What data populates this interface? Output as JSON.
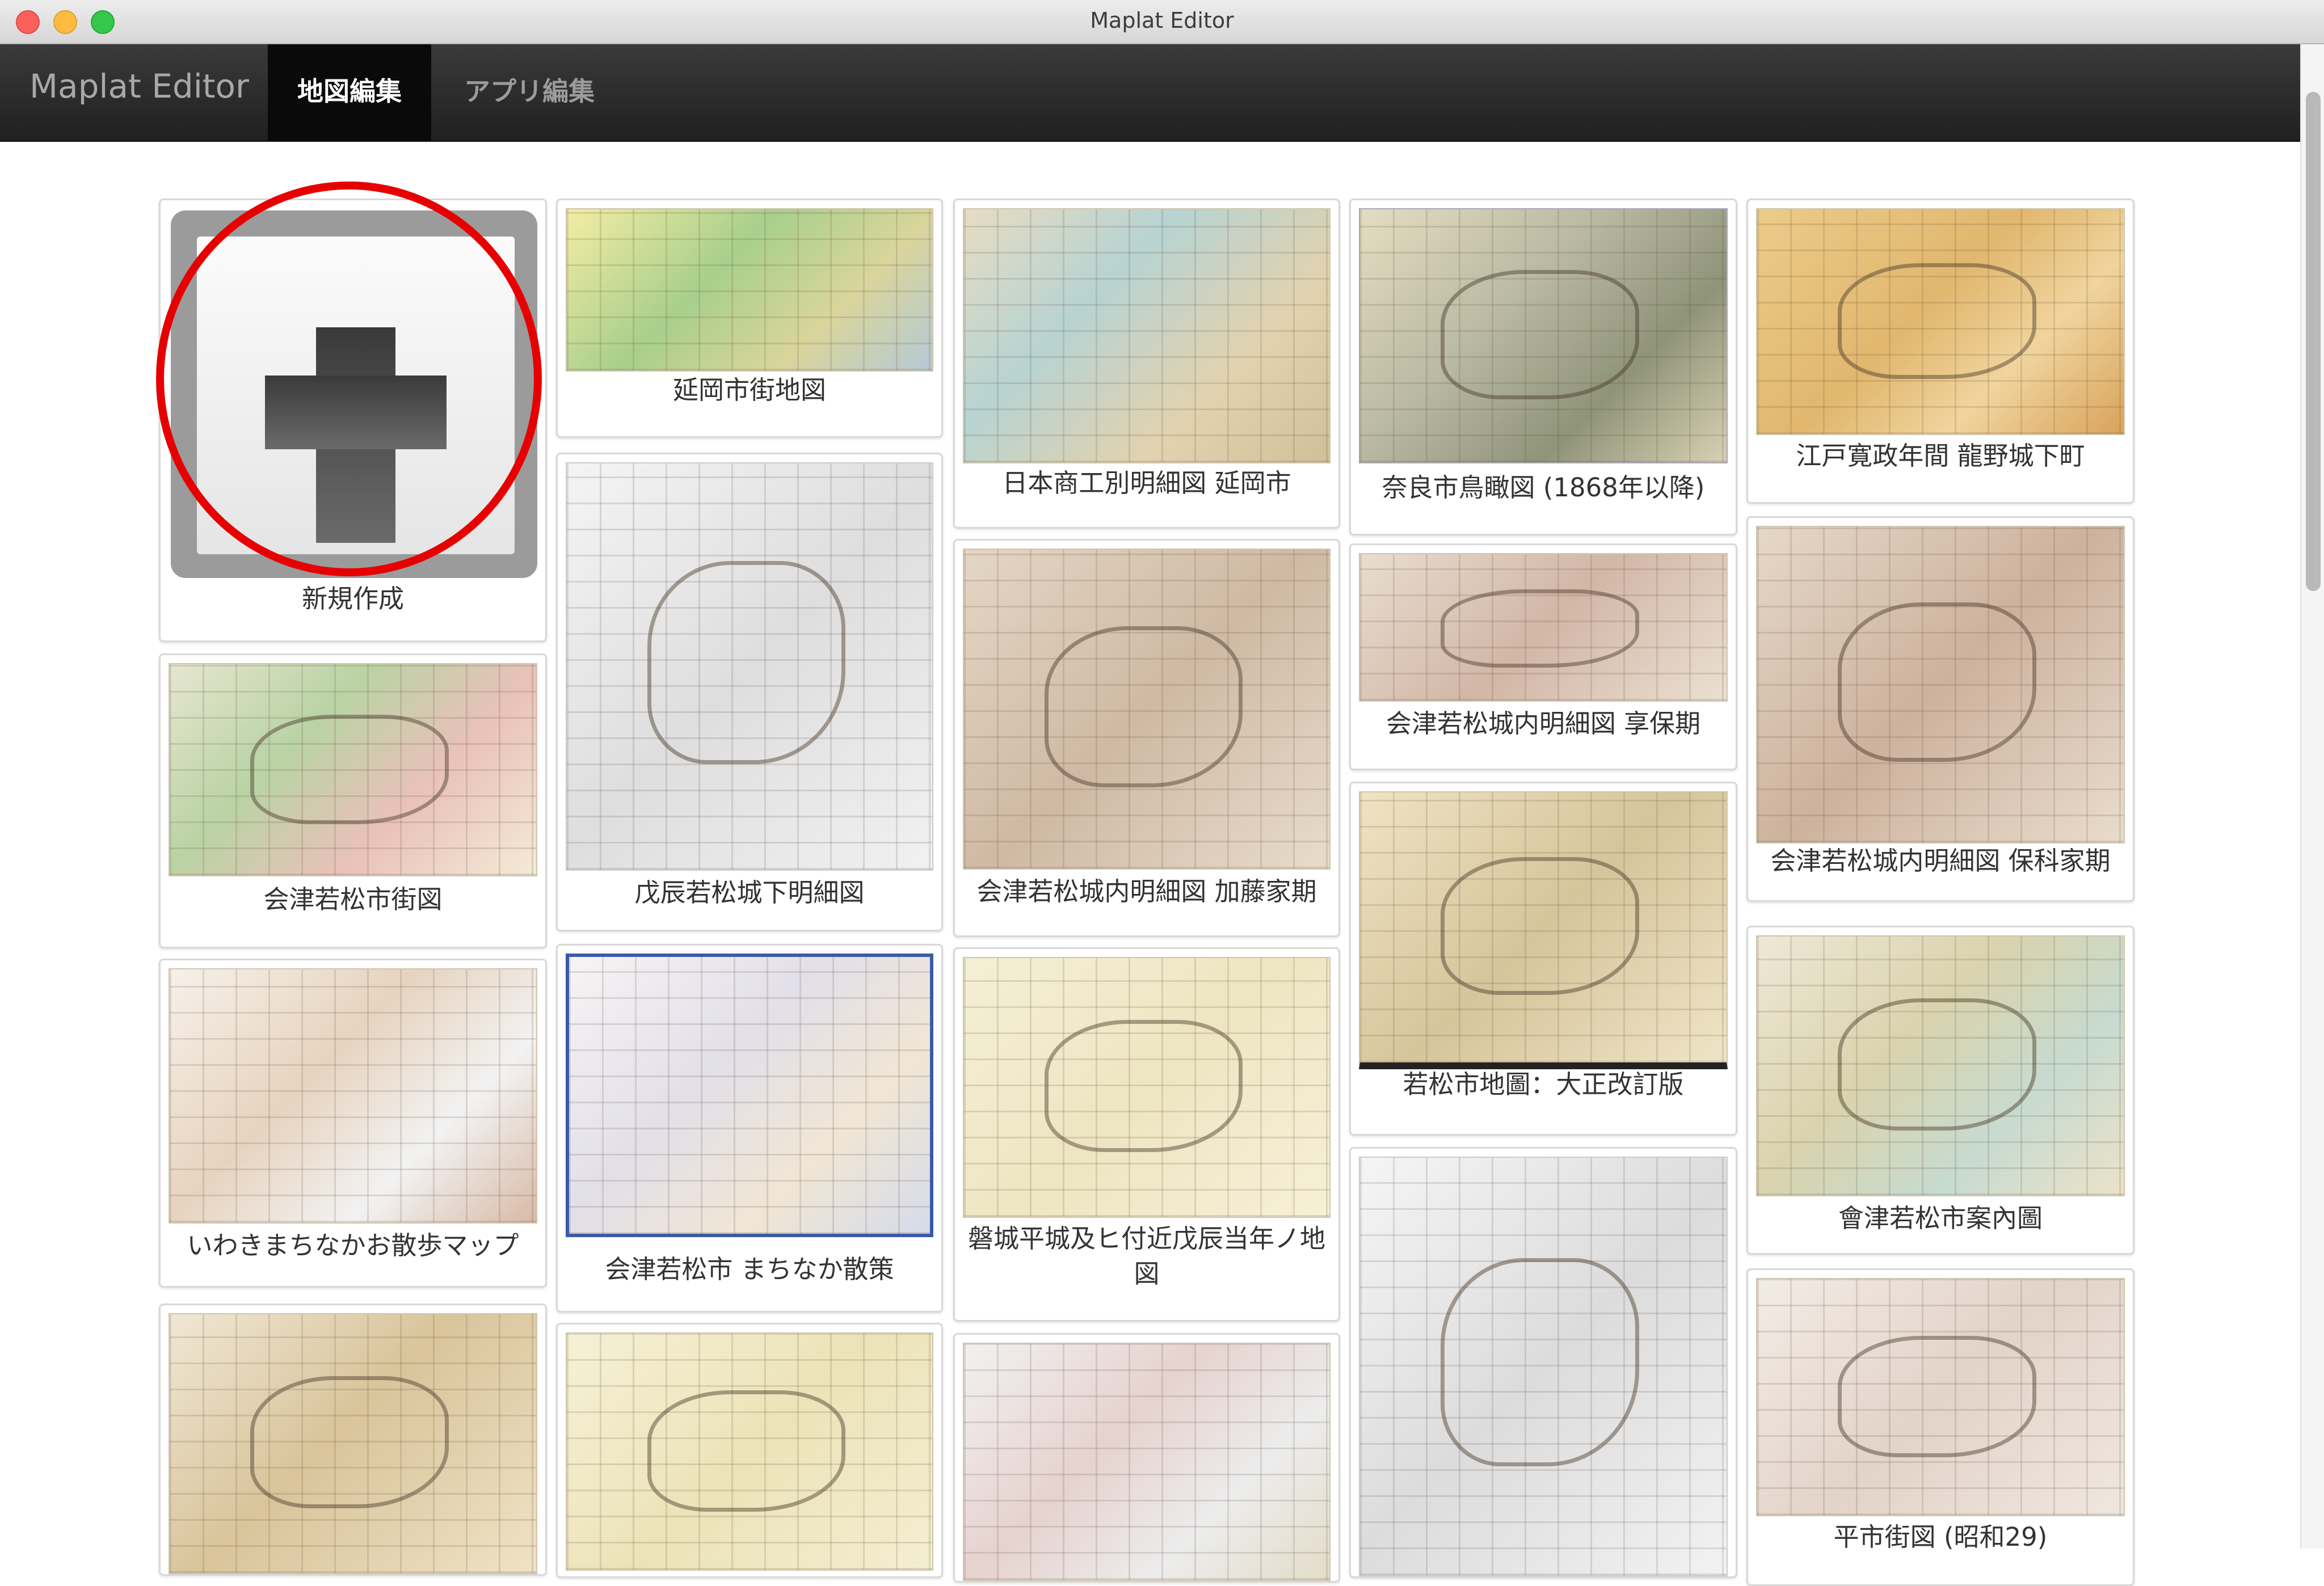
{
  "window": {
    "title": "Maplat Editor"
  },
  "navbar": {
    "brand": "Maplat Editor",
    "tabs": [
      {
        "label": "地図編集",
        "active": true
      },
      {
        "label": "アプリ編集",
        "active": false
      }
    ]
  },
  "new_card": {
    "label": "新規作成"
  },
  "maps": [
    {
      "title": "延岡市街地図"
    },
    {
      "title": "日本商工別明細図 延岡市"
    },
    {
      "title": "奈良市鳥瞰図 (1868年以降)"
    },
    {
      "title": "江戸寛政年間 龍野城下町"
    },
    {
      "title": "会津若松市街図"
    },
    {
      "title": "戊辰若松城下明細図"
    },
    {
      "title": "会津若松城内明細図 加藤家期"
    },
    {
      "title": "会津若松城内明細図 享保期"
    },
    {
      "title": "会津若松城内明細図 保科家期"
    },
    {
      "title": "若松市地圖：大正改訂版"
    },
    {
      "title": "いわきまちなかお散歩マップ"
    },
    {
      "title": "会津若松市 まちなか散策"
    },
    {
      "title": "磐城平城及ヒ付近戊辰当年ノ地図"
    },
    {
      "title": "會津若松市案內圖"
    },
    {
      "title": "平市街図 (昭和29)"
    }
  ],
  "colors": {
    "navbar": "#202020",
    "active_tab": "#0a0a0a",
    "highlight_ring": "#e60000"
  }
}
